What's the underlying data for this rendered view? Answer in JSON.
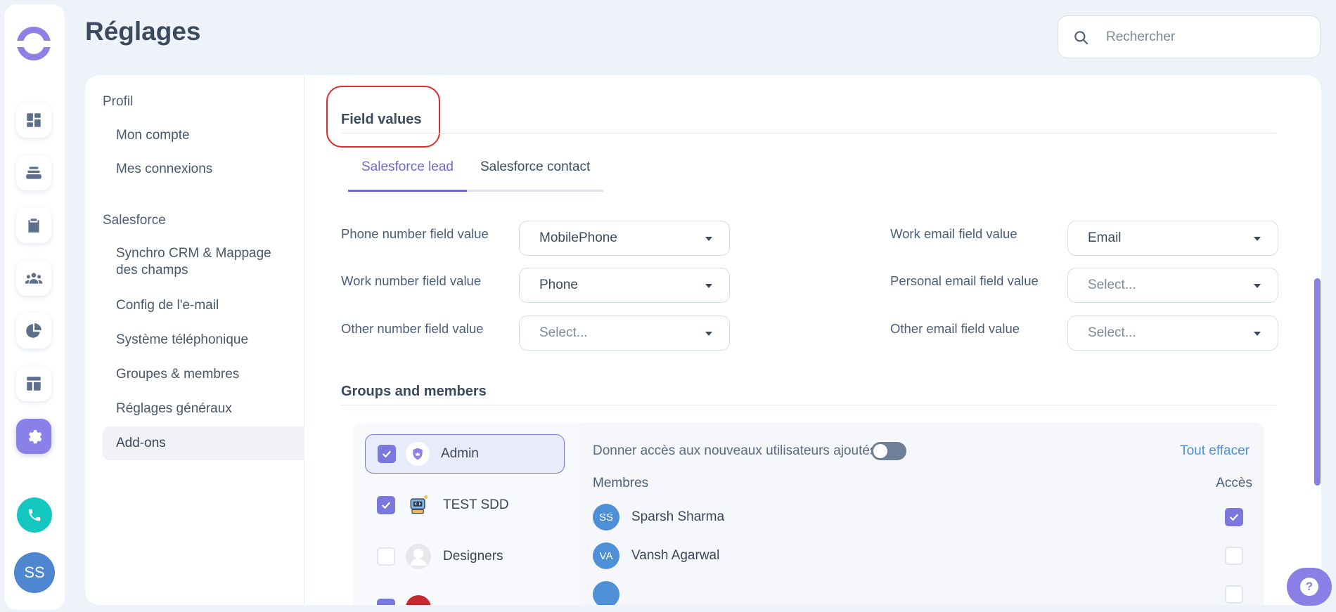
{
  "header": {
    "title": "Réglages",
    "search_placeholder": "Rechercher"
  },
  "rail": {
    "avatar_initials": "SS"
  },
  "sidebar": {
    "sections": [
      {
        "label": "Profil",
        "items": [
          "Mon compte",
          "Mes connexions"
        ]
      },
      {
        "label": "Salesforce",
        "items": [
          "Synchro CRM & Mappage des champs",
          "Config de l'e-mail",
          "Système téléphonique",
          "Groupes & membres",
          "Réglages généraux",
          "Add-ons"
        ]
      }
    ],
    "profil": "Profil",
    "mon_compte": "Mon compte",
    "mes_connexions": "Mes connexions",
    "salesforce": "Salesforce",
    "synchro": "Synchro CRM & Mappage des champs",
    "config_email": "Config de l'e-mail",
    "systeme_tel": "Système téléphonique",
    "groupes": "Groupes & membres",
    "reglages_generaux": "Réglages généraux",
    "addons": "Add-ons",
    "active_item": "Add-ons"
  },
  "field_values": {
    "title": "Field values",
    "tabs": [
      "Salesforce lead",
      "Salesforce contact"
    ],
    "active_tab": "Salesforce lead",
    "phone_label": "Phone number field value",
    "phone_value": "MobilePhone",
    "work_number_label": "Work number field value",
    "work_number_value": "Phone",
    "other_number_label": "Other number field value",
    "other_number_placeholder": "Select...",
    "work_email_label": "Work email field value",
    "work_email_value": "Email",
    "personal_email_label": "Personal email field value",
    "personal_email_placeholder": "Select...",
    "other_email_label": "Other email field value",
    "other_email_placeholder": "Select..."
  },
  "groups": {
    "title": "Groups and members",
    "list": [
      {
        "name": "Admin",
        "checked": true,
        "selected": true
      },
      {
        "name": "TEST SDD",
        "checked": true
      },
      {
        "name": "Designers",
        "checked": false
      }
    ],
    "g0": "Admin",
    "g1": "TEST SDD",
    "g2": "Designers",
    "access_new_users": "Donner accès aux nouveaux utilisateurs ajoutés",
    "access_new_users_on": false,
    "clear_all": "Tout effacer",
    "col_members": "Membres",
    "col_access": "Accès",
    "members": [
      {
        "initials": "SS",
        "name": "Sparsh Sharma",
        "access": true
      },
      {
        "initials": "VA",
        "name": "Vansh Agarwal",
        "access": false
      }
    ],
    "m0_initials": "SS",
    "m0_name": "Sparsh Sharma",
    "m1_initials": "VA",
    "m1_name": "Vansh Agarwal"
  },
  "colors": {
    "accent": "#7a78de",
    "link": "#4b8fe0",
    "highlight_box": "#e02b2b",
    "phone": "#12c8c0"
  }
}
